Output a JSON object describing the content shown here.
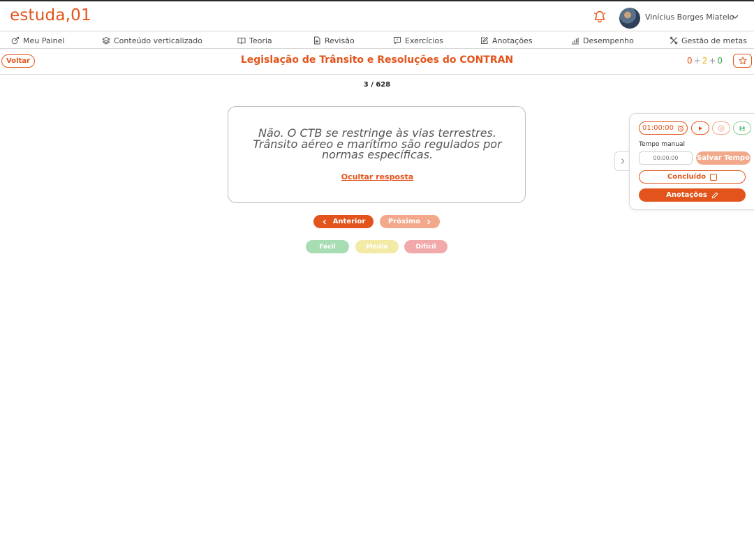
{
  "header": {
    "logo": "estuda,01",
    "user_name": "Vinícius Borges Miatelo",
    "icons": [
      "bell-icon",
      "avatar",
      "chevron-down-icon"
    ]
  },
  "nav": {
    "items": [
      {
        "label": "Meu Painel",
        "icon": "dashboard-icon"
      },
      {
        "label": "Conteúdo verticalizado",
        "icon": "layers-icon"
      },
      {
        "label": "Teoria",
        "icon": "book-icon"
      },
      {
        "label": "Revisão",
        "icon": "document-icon"
      },
      {
        "label": "Exercícios",
        "icon": "chat-check-icon"
      },
      {
        "label": "Anotações",
        "icon": "edit-icon"
      },
      {
        "label": "Desempenho",
        "icon": "bar-chart-icon"
      },
      {
        "label": "Gestão de metas",
        "icon": "tools-icon"
      }
    ]
  },
  "subheader": {
    "back_label": "Voltar",
    "title": "Legislação de Trânsito e Resoluções do CONTRAN",
    "score": {
      "wrong": "0",
      "partial": "2",
      "right": "0",
      "sep": "+"
    }
  },
  "flashcard": {
    "counter": "3 / 628",
    "answer": "Não. O CTB se restringe às vias terrestres. Trânsito aéreo e marítimo são regulados por normas específicas.",
    "hide_link": "Ocultar resposta"
  },
  "navigation": {
    "prev_label": "Anterior",
    "next_label": "Próximo"
  },
  "difficulty": {
    "easy": "Fácil",
    "medium": "Média",
    "hard": "Difícil"
  },
  "timer_panel": {
    "timer_value": "01:00:00",
    "manual_label": "Tempo manual",
    "manual_placeholder": "00:00:00",
    "save_time_label": "Salvar Tempo",
    "done_label": "Concluído",
    "notes_label": "Anotações"
  },
  "colors": {
    "accent": "#e2541b",
    "accent_light": "#f2a88a",
    "easy": "#a8dcb2",
    "medium": "#f3eaa6",
    "hard": "#f2a9a9"
  }
}
